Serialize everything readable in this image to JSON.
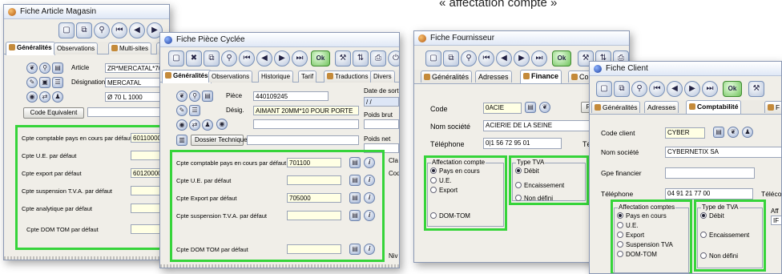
{
  "heading": "« affectation compte »",
  "article": {
    "title": "Fiche Article Magasin",
    "tabs": [
      "Généralités",
      "Observations",
      "Multi-sites",
      "D"
    ],
    "fields": {
      "article_label": "Article",
      "article_value": "ZR*MERCATAL*70",
      "designation_label": "Désignation",
      "designation_value": "MERCATAL",
      "dim_value": "Ø 70 L 1000"
    },
    "code_equiv_button": "Code Equivalent",
    "accounts": [
      {
        "label": "Cpte comptable pays en cours par défaut",
        "value": "60110000"
      },
      {
        "label": "Cpte U.E. par défaut",
        "value": ""
      },
      {
        "label": "Cpte export par défaut",
        "value": "60120000"
      },
      {
        "label": "Cpte suspension T.V.A. par défaut",
        "value": ""
      },
      {
        "label": "Cpte analytique par défaut",
        "value": ""
      },
      {
        "label": "Cpte DOM TOM par défaut",
        "value": ""
      }
    ]
  },
  "piece": {
    "title": "Fiche Pièce Cyclée",
    "tabs": [
      "Généralités",
      "Observations",
      "Historique",
      "Tarif",
      "Traductions",
      "Divers"
    ],
    "fields": {
      "piece_label": "Pièce",
      "piece_value": "440109245",
      "desig_label": "Désig.",
      "desig_value": "AIMANT 20MM*10 POUR PORTE"
    },
    "dossier_button": "Dossier Technique",
    "side_labels": [
      "Date de sortie",
      "Poids brut",
      "Poids net",
      "Cla",
      "Cod",
      "Niv"
    ],
    "date_placeholder": "/ /",
    "accounts": [
      {
        "label": "Cpte comptable pays en cours par défaut",
        "value": "701100"
      },
      {
        "label": "Cpte U.E. par défaut",
        "value": ""
      },
      {
        "label": "Cpte Export par défaut",
        "value": "705000"
      },
      {
        "label": "Cpte suspension T.V.A. par défaut",
        "value": ""
      },
      {
        "label": "Cpte DOM TOM par défaut",
        "value": ""
      }
    ]
  },
  "fournisseur": {
    "title": "Fiche Fournisseur",
    "tabs": [
      "Généralités",
      "Adresses",
      "Finance",
      "Co"
    ],
    "code_label": "Code",
    "code_value": "0ACIE",
    "rem_button": "Rem",
    "nom_label": "Nom société",
    "nom_value": "ACIERIE DE LA SEINE",
    "tel_label": "Téléphone",
    "tel_value": "0|1 56 72 95 01",
    "telecopie_label": "Télécopie",
    "affectation_title": "Affectation compte",
    "affectation_options": [
      "Pays en cours",
      "U.E.",
      "Export",
      "DOM-TOM"
    ],
    "affectation_selected": "Pays en cours",
    "tva_title": "Type TVA",
    "tva_options": [
      "Débit",
      "Encaissement",
      "Non défini"
    ],
    "tva_selected": "Débit"
  },
  "client": {
    "title": "Fiche Client",
    "tabs": [
      "Généralités",
      "Adresses",
      "Comptabilité",
      "F"
    ],
    "code_label": "Code client",
    "code_value": "CYBER",
    "nom_label": "Nom société",
    "nom_value": "CYBERNETIX SA",
    "gpe_label": "Gpe financier",
    "gpe_value": "",
    "tel_label": "Téléphone",
    "tel_value": "04 91 21 77 00",
    "telecopie_label": "Téléco",
    "affectation_title": "Affectation comptes",
    "affectation_options": [
      "Pays en cours",
      "U.E.",
      "Export",
      "Suspension TVA",
      "DOM-TOM"
    ],
    "affectation_selected": "Pays en cours",
    "tva_title": "Type de TVA",
    "tva_options": [
      "Débit",
      "Encaissement",
      "Non défini"
    ],
    "tva_selected": "Débit",
    "aff_label": "Aff",
    "aff_value": "IF"
  },
  "colors": {
    "highlight": "#36d43a",
    "title_gradient": "#dfe8f6",
    "field_yellow": "#ffffe4"
  }
}
